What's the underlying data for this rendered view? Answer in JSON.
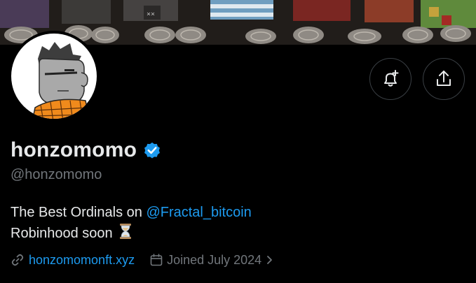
{
  "banner": {
    "icon": "knitted-plush-figures-image"
  },
  "avatar": {
    "icon": "grey-character-orange-scarf-avatar"
  },
  "actions": {
    "notify_icon": "bell-plus-icon",
    "share_icon": "share-upload-icon"
  },
  "profile": {
    "display_name": "honzomomo",
    "handle": "@honzomomo",
    "verified_icon": "verified-badge-icon",
    "bio_line1_prefix": "The Best Ordinals on ",
    "bio_mention": "@Fractal_bitcoin",
    "bio_line2": "Robinhood soon",
    "bio_emoji_icon": "hourglass-icon"
  },
  "meta": {
    "link_text": "honzomomonft.xyz",
    "joined_text": "Joined July 2024"
  },
  "colors": {
    "accent": "#1d9bf0",
    "secondary_text": "#71767b",
    "primary_text": "#e7e9ea",
    "background": "#000000"
  }
}
